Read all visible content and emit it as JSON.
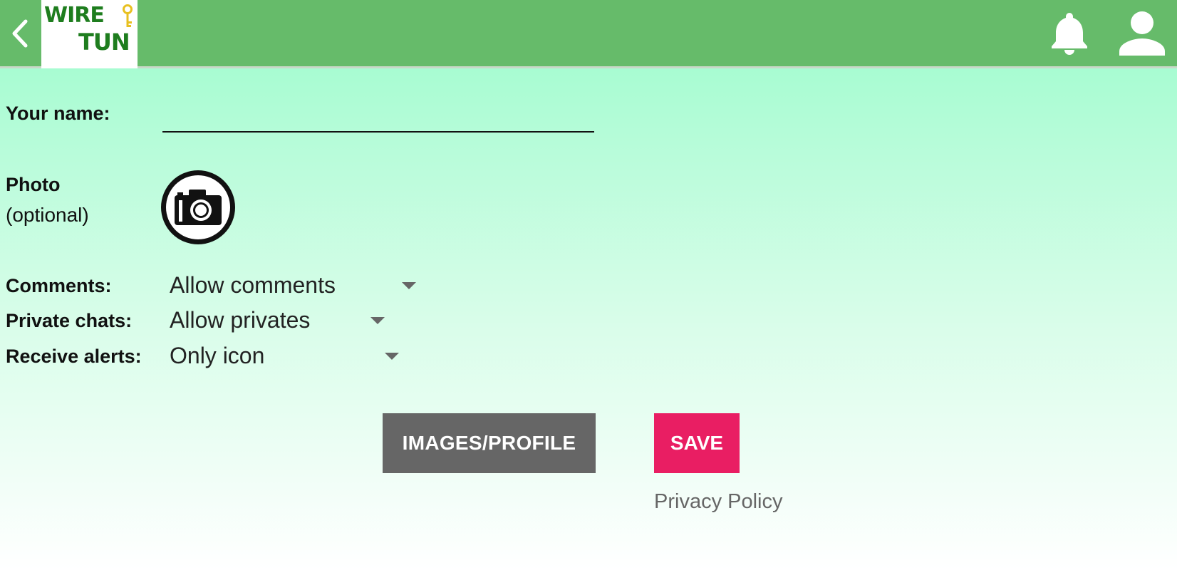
{
  "appbar": {
    "logo_line1": "WIRE",
    "logo_line2": "TUN",
    "accent_color": "#66bb6a",
    "icons": [
      "chevron-left-icon",
      "bell-icon",
      "user-icon"
    ]
  },
  "form": {
    "name_label": "Your name:",
    "name_value": "",
    "photo_label": "Photo",
    "photo_sublabel": "(optional)",
    "comments_label": "Comments:",
    "comments_value": "Allow comments",
    "private_label": "Private chats:",
    "private_value": "Allow privates",
    "alerts_label": "Receive alerts:",
    "alerts_value": "Only icon"
  },
  "actions": {
    "images_label": "IMAGES/PROFILE",
    "save_label": "SAVE",
    "privacy_label": "Privacy Policy",
    "save_color": "#e91e63",
    "images_color": "#666666"
  }
}
